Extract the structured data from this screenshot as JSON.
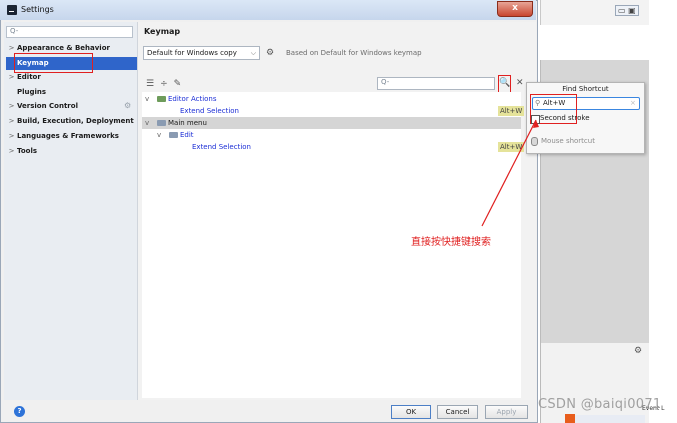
{
  "window": {
    "title": "Settings",
    "close": "x"
  },
  "sidebar": {
    "search_placeholder": "Q-",
    "items": [
      {
        "label": "Appearance & Behavior",
        "arrow": ">"
      },
      {
        "label": "Keymap",
        "arrow": ""
      },
      {
        "label": "Editor",
        "arrow": ">"
      },
      {
        "label": "Plugins",
        "arrow": ""
      },
      {
        "label": "Version Control",
        "arrow": ">"
      },
      {
        "label": "Build, Execution, Deployment",
        "arrow": ">"
      },
      {
        "label": "Languages & Frameworks",
        "arrow": ">"
      },
      {
        "label": "Tools",
        "arrow": ">"
      }
    ]
  },
  "main": {
    "heading": "Keymap",
    "keymap_select": "Default for Windows copy",
    "based_on": "Based on Default for Windows keymap",
    "filter_placeholder": "Q-",
    "tree": [
      {
        "label": "Editor Actions",
        "arrow": "v",
        "shortcut": ""
      },
      {
        "label": "Extend Selection",
        "arrow": "",
        "shortcut": "Alt+W"
      },
      {
        "label": "Main menu",
        "arrow": "v",
        "shortcut": ""
      },
      {
        "label": "Edit",
        "arrow": "v",
        "shortcut": ""
      },
      {
        "label": "Extend Selection",
        "arrow": "",
        "shortcut": "Alt+W"
      }
    ]
  },
  "buttons": {
    "ok": "OK",
    "cancel": "Cancel",
    "apply": "Apply",
    "help": "?"
  },
  "find_shortcut": {
    "title": "Find Shortcut",
    "input_value": "Alt+W",
    "second_stroke": "Second stroke",
    "mouse_shortcut": "Mouse shortcut"
  },
  "annotation": "直接按快捷键搜索",
  "watermark": "CSDN @baiqi0071",
  "ide": {
    "event_log": "Event L"
  },
  "colors": {
    "selection": "#2f65ca",
    "annotation": "#e02020",
    "shortcut_bg": "#e5e39a"
  }
}
